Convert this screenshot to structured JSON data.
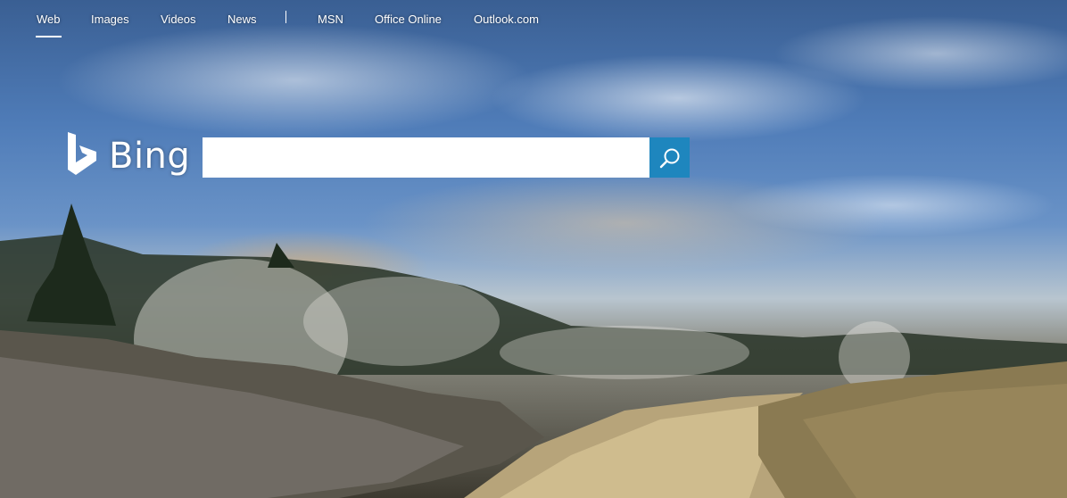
{
  "nav": {
    "items": [
      {
        "label": "Web",
        "active": true
      },
      {
        "label": "Images"
      },
      {
        "label": "Videos"
      },
      {
        "label": "News"
      },
      {
        "label": "MSN"
      },
      {
        "label": "Office Online"
      },
      {
        "label": "Outlook.com"
      }
    ],
    "separator": "|"
  },
  "logo": {
    "text": "Bing",
    "icon": "bing-b-icon"
  },
  "search": {
    "value": "",
    "placeholder": "",
    "button_icon": "search-icon",
    "button_color": "#1e86be"
  },
  "background": {
    "scene": "landscape-photo"
  }
}
